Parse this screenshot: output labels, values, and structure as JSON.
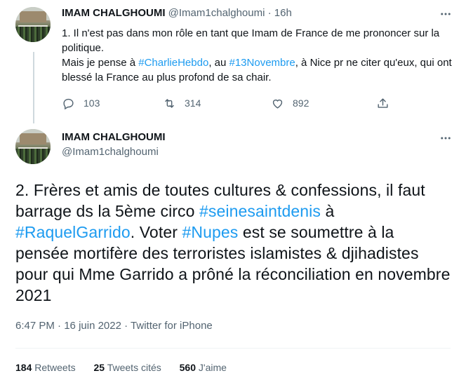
{
  "tweet1": {
    "author_name": "IMAM CHALGHOUMI",
    "handle": "@Imam1chalghoumi",
    "separator": "·",
    "time": "16h",
    "line1": "1. Il n'est pas dans mon rôle en tant que Imam de France de me prononcer sur la politique.",
    "line2_a": "Mais je pense à ",
    "line2_link1": "#CharlieHebdo",
    "line2_b": ", au ",
    "line2_link2": "#13Novembre",
    "line2_c": ", à Nice pr ne citer qu'eux, qui ont blessé la France au plus profond de sa chair.",
    "replies": "103",
    "retweets": "314",
    "likes": "892"
  },
  "tweet2": {
    "author_name": "IMAM CHALGHOUMI",
    "handle": "@Imam1chalghoumi",
    "text_a": "2. Frères et amis de toutes cultures & confessions, il faut  barrage ds la 5ème circo ",
    "link1": "#seinesaintdenis",
    "text_b": " à ",
    "link2": "#RaquelGarrido",
    "text_c": ". Voter ",
    "link3": "#Nupes",
    "text_d": " est se soumettre à la pensée mortifère des terroristes islamistes & djihadistes pour qui Mme Garrido a prôné la réconciliation en novembre 2021",
    "time": "6:47 PM",
    "separator1": " · ",
    "date": "16 juin 2022",
    "separator2": " · ",
    "source": "Twitter for iPhone",
    "stats": {
      "retweets_count": "184",
      "retweets_label": "Retweets",
      "quotes_count": "25",
      "quotes_label": "Tweets cités",
      "likes_count": "560",
      "likes_label": "J'aime"
    }
  },
  "icons": {
    "more": "more-dots-icon",
    "reply": "reply-bubble-icon",
    "retweet": "retweet-arrows-icon",
    "like": "heart-icon",
    "share": "share-upload-icon"
  },
  "colors": {
    "link": "#1d9bf0",
    "muted": "#536471",
    "text": "#0f1419",
    "thread_line": "#cfd9de"
  }
}
